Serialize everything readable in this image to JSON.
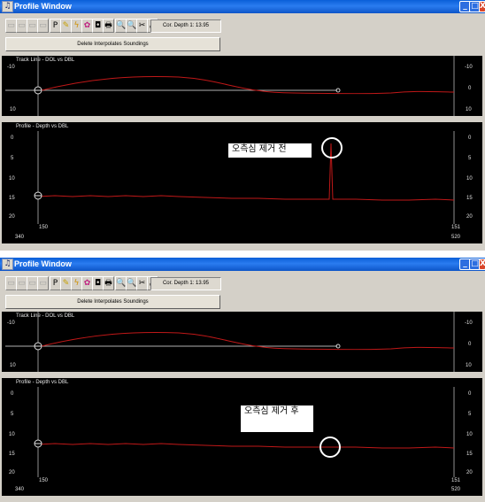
{
  "window": {
    "title": "Profile Window",
    "controls": {
      "minimize": "_",
      "maximize": "□",
      "close": "X"
    }
  },
  "toolbar": {
    "tools": [
      "▭",
      "▭",
      "▭",
      "▭",
      "P",
      "✎",
      "ϟ",
      "✿",
      "◘",
      "🖶",
      "🔍",
      "🔍",
      "✂",
      "⤢"
    ],
    "depth_readout": "Cor. Depth 1: 13.95",
    "delete_button": "Delete Interpolates Soundings"
  },
  "track_panel": {
    "label": "Track Line - DOL vs DBL",
    "left_ticks": [
      "-10",
      "0",
      "10"
    ],
    "right_ticks": [
      "-10",
      "0",
      "10"
    ]
  },
  "profile_panel": {
    "label": "Profile - Depth vs DBL",
    "y_ticks": [
      "0",
      "5",
      "10",
      "15",
      "20"
    ],
    "x_ticks": [
      "340",
      "150",
      "151",
      "520"
    ]
  },
  "screens": [
    {
      "caption": "오측심 제거 전"
    },
    {
      "caption": "오측심      제거 후"
    }
  ],
  "colors": {
    "trace": "#c01818",
    "marker": "#ffffff",
    "grid": "#808080"
  }
}
